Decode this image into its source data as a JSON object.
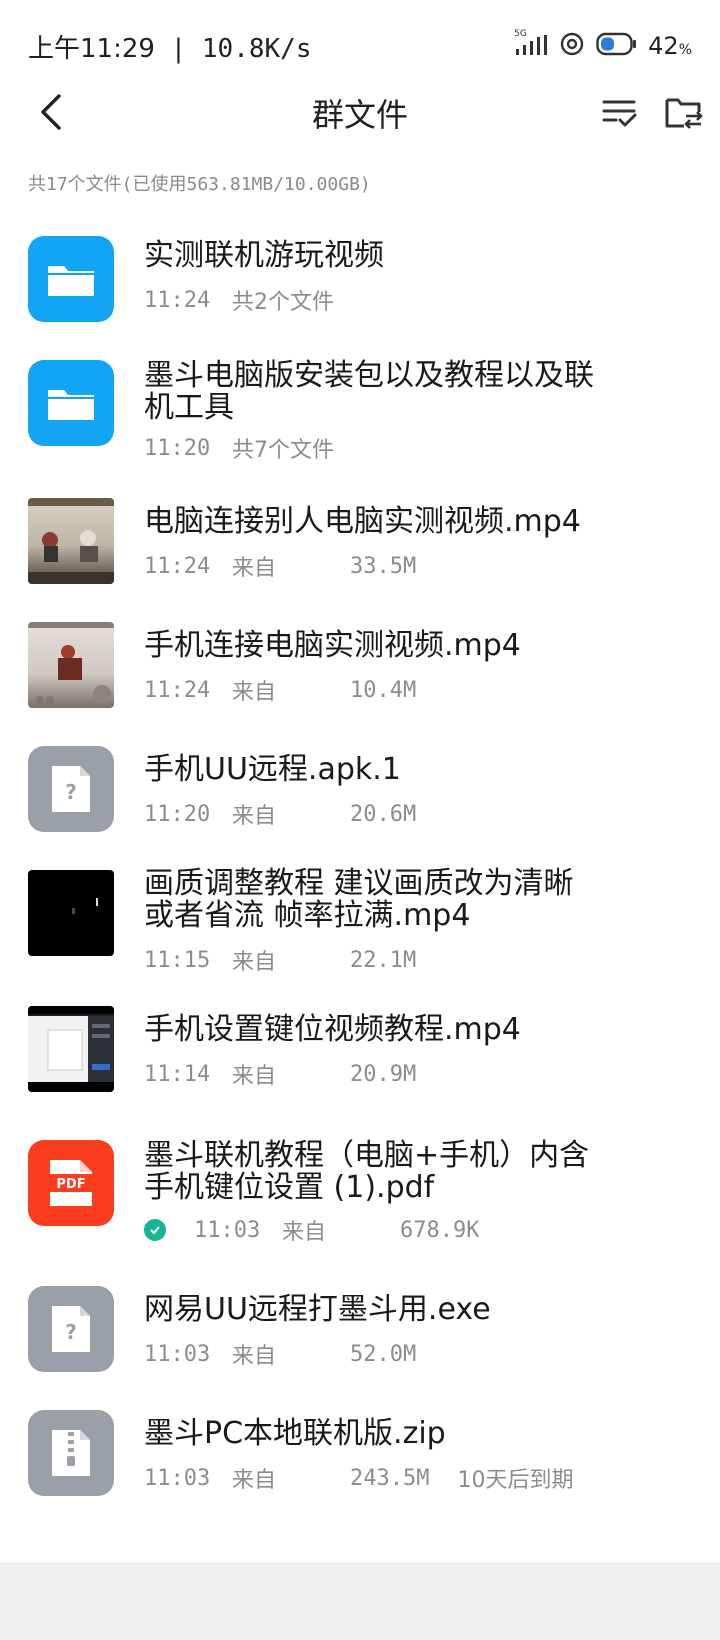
{
  "status_bar": {
    "time": "上午11:29",
    "speed": "10.8K/s",
    "network_label": "5G",
    "battery": "42",
    "battery_unit": "%",
    "icons": [
      "signal-icon",
      "hotspot-icon",
      "battery-icon"
    ]
  },
  "header": {
    "title": "群文件",
    "back_icon": "chevron-left-icon",
    "actions": [
      "sort-icon",
      "folder-sync-icon"
    ]
  },
  "summary": "共17个文件(已使用563.81MB/10.00GB)",
  "colors": {
    "folder": "#12a4f5",
    "pdf": "#fb3c1e",
    "generic": "#9aa0a7",
    "check": "#1ab394",
    "meta_text": "#8c8c8c"
  },
  "files": [
    {
      "name": "实测联机游玩视频",
      "time": "11:24",
      "from": "共2个文件",
      "size": "",
      "extra": "",
      "icon": "folder-icon"
    },
    {
      "name": "墨斗电脑版安装包以及教程以及联机工具",
      "time": "11:20",
      "from": "共7个文件",
      "size": "",
      "extra": "",
      "icon": "folder-icon"
    },
    {
      "name": "电脑连接别人电脑实测视频.mp4",
      "time": "11:24",
      "from": "来自",
      "size": "33.5M",
      "extra": "",
      "icon": "video-thumbnail"
    },
    {
      "name": "手机连接电脑实测视频.mp4",
      "time": "11:24",
      "from": "来自",
      "size": "10.4M",
      "extra": "",
      "icon": "video-thumbnail"
    },
    {
      "name": "手机UU远程.apk.1",
      "time": "11:20",
      "from": "来自",
      "size": "20.6M",
      "extra": "",
      "icon": "unknown-file-icon"
    },
    {
      "name": "画质调整教程 建议画质改为清晰或者省流 帧率拉满.mp4",
      "time": "11:15",
      "from": "来自",
      "size": "22.1M",
      "extra": "",
      "icon": "video-thumbnail"
    },
    {
      "name": "手机设置键位视频教程.mp4",
      "time": "11:14",
      "from": "来自",
      "size": "20.9M",
      "extra": "",
      "icon": "video-thumbnail"
    },
    {
      "name": "墨斗联机教程（电脑+手机）内含手机键位设置 (1).pdf",
      "time": "11:03",
      "from": "来自",
      "size": "678.9K",
      "extra": "",
      "icon": "pdf-icon",
      "pdf_label": "PDF"
    },
    {
      "name": "网易UU远程打墨斗用.exe",
      "time": "11:03",
      "from": "来自",
      "size": "52.0M",
      "extra": "",
      "icon": "unknown-file-icon"
    },
    {
      "name": "墨斗PC本地联机版.zip",
      "time": "11:03",
      "from": "来自",
      "size": "243.5M",
      "extra": "10天后到期",
      "icon": "zip-file-icon"
    }
  ]
}
